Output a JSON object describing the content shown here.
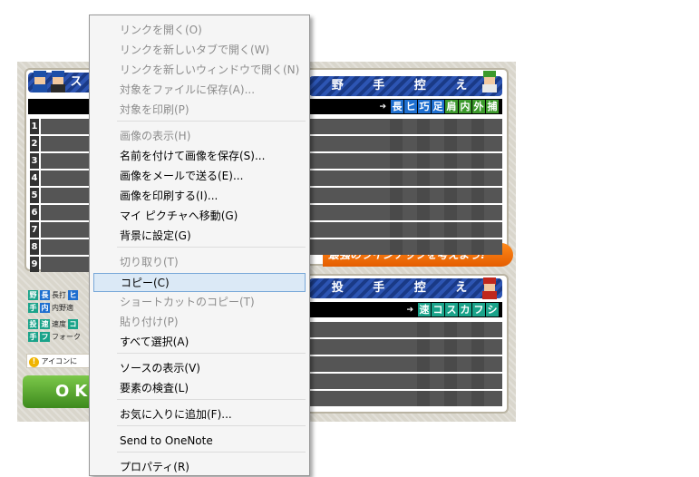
{
  "game": {
    "fielders_reserve_title": "野 手 控 え",
    "pitchers_reserve_title": "投 手 控 え",
    "lineup_title_partial": "ス",
    "fielder_stat_abbrs": [
      "長",
      "ヒ",
      "巧",
      "足",
      "肩",
      "内",
      "外",
      "捕"
    ],
    "pitcher_stat_abbrs": [
      "速",
      "コ",
      "ス",
      "カ",
      "フ",
      "シ"
    ],
    "batting_order": [
      "1",
      "2",
      "3",
      "4",
      "5",
      "6",
      "7",
      "8",
      "9"
    ],
    "promo_text": "最強のラインナップを考えよう!",
    "legend": {
      "fielder_tag": "野",
      "fielder_tag2": "手",
      "pitcher_tag": "投",
      "pitcher_tag2": "手",
      "cho": "長",
      "cho_text": "長打",
      "hi": "ヒ",
      "nai": "内",
      "nai_text": "内野適",
      "soku": "速",
      "soku_text": "速度",
      "ko": "コ",
      "fu": "フ",
      "fu_text": "フォーク"
    },
    "notice_text": "アイコンに",
    "ok_label": "OK"
  },
  "context_menu": {
    "items": [
      {
        "label": "リンクを開く(O)",
        "enabled": false
      },
      {
        "label": "リンクを新しいタブで開く(W)",
        "enabled": false
      },
      {
        "label": "リンクを新しいウィンドウで開く(N)",
        "enabled": false
      },
      {
        "label": "対象をファイルに保存(A)...",
        "enabled": false
      },
      {
        "label": "対象を印刷(P)",
        "enabled": false
      },
      {
        "label": "画像の表示(H)",
        "enabled": false
      },
      {
        "label": "名前を付けて画像を保存(S)...",
        "enabled": true
      },
      {
        "label": "画像をメールで送る(E)...",
        "enabled": true
      },
      {
        "label": "画像を印刷する(I)...",
        "enabled": true
      },
      {
        "label": "マイ ピクチャへ移動(G)",
        "enabled": true
      },
      {
        "label": "背景に設定(G)",
        "enabled": true
      },
      {
        "label": "切り取り(T)",
        "enabled": false
      },
      {
        "label": "コピー(C)",
        "enabled": true,
        "highlighted": true
      },
      {
        "label": "ショートカットのコピー(T)",
        "enabled": false
      },
      {
        "label": "貼り付け(P)",
        "enabled": false
      },
      {
        "label": "すべて選択(A)",
        "enabled": true
      },
      {
        "label": "ソースの表示(V)",
        "enabled": true
      },
      {
        "label": "要素の検査(L)",
        "enabled": true
      },
      {
        "label": "お気に入りに追加(F)...",
        "enabled": true
      },
      {
        "label": "Send to OneNote",
        "enabled": true
      },
      {
        "label": "プロパティ(R)",
        "enabled": true
      }
    ]
  },
  "colors": {
    "banner_blue": "#1d3f8f",
    "menu_highlight": "#dbe9f6",
    "promo_orange": "#e55d00",
    "ok_green": "#3d8a1d"
  }
}
